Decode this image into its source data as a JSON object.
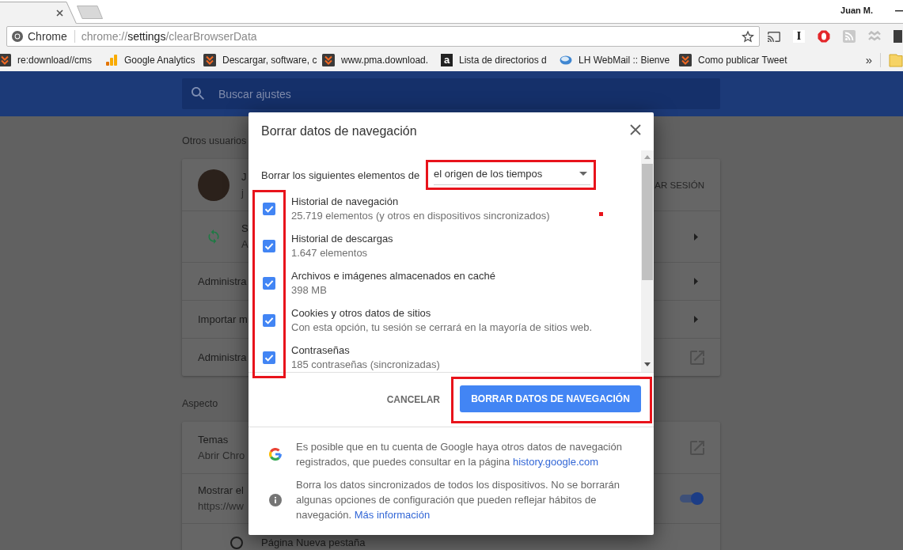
{
  "browser": {
    "profile_name": "Juan M.",
    "omnibox": {
      "chip": "Chrome",
      "url": {
        "scheme": "chrome://",
        "host": "settings",
        "path": "/clearBrowserData"
      },
      "starred": false
    },
    "extensions": [
      {
        "kind": "cast"
      },
      {
        "kind": "glyph",
        "glyph": "I"
      },
      {
        "kind": "octagon"
      },
      {
        "kind": "feed"
      },
      {
        "kind": "squiggle"
      },
      {
        "kind": "tile"
      }
    ],
    "bookmarks": [
      {
        "kind": "chevrons",
        "label": "re:download//cms"
      },
      {
        "kind": "bars",
        "label": "Google Analytics"
      },
      {
        "kind": "chevrons",
        "label": "Descargar, software, c"
      },
      {
        "kind": "chevrons",
        "label": "www.pma.download."
      },
      {
        "kind": "glyph",
        "glyph": "a",
        "label": "Lista de directorios d"
      },
      {
        "kind": "disc",
        "label": "LH WebMail :: Bienve"
      },
      {
        "kind": "chevrons",
        "label": "Como publicar Tweet"
      }
    ],
    "bookmarks_overflow": "»"
  },
  "settings": {
    "search": {
      "placeholder": "Buscar ajustes"
    },
    "sections": [
      {
        "title": "Otros usuarios",
        "rows": [
          {
            "kind": "profile",
            "title": "J",
            "subtitle": "j",
            "action": "AR SESIÓN"
          },
          {
            "kind": "sync",
            "title": "S",
            "subtitle": "A"
          },
          {
            "kind": "submenu",
            "title": "Administra"
          },
          {
            "kind": "submenu",
            "title": "Importar m"
          },
          {
            "kind": "external",
            "title": "Administra"
          }
        ]
      },
      {
        "title": "Aspecto",
        "rows": [
          {
            "kind": "external",
            "title": "Temas",
            "subtitle": "Abrir Chro"
          },
          {
            "kind": "toggle",
            "title": "Mostrar el",
            "subtitle": "https://ww",
            "on": true
          },
          {
            "kind": "radio",
            "title": "Página Nueva pestaña",
            "selected": false
          }
        ]
      }
    ]
  },
  "dialog": {
    "title": "Borrar datos de navegación",
    "range": {
      "label": "Borrar los siguientes elementos de",
      "value": "el origen de los tiempos",
      "highlighted": true
    },
    "items_highlighted": true,
    "items": [
      {
        "title": "Historial de navegación",
        "subtitle": "25.719 elementos (y otros en dispositivos sincronizados)",
        "checked": true
      },
      {
        "title": "Historial de descargas",
        "subtitle": "1.647 elementos",
        "checked": true
      },
      {
        "title": "Archivos e imágenes almacenados en caché",
        "subtitle": "398 MB",
        "checked": true
      },
      {
        "title": "Cookies y otros datos de sitios",
        "subtitle": "Con esta opción, tu sesión se cerrará en la mayoría de sitios web.",
        "checked": true
      },
      {
        "title": "Contraseñas",
        "subtitle": "185 contraseñas (sincronizadas)",
        "checked": true
      }
    ],
    "cancel": "CANCELAR",
    "confirm": {
      "label": "BORRAR DATOS DE NAVEGACIÓN",
      "highlighted": true
    },
    "notes": [
      {
        "kind": "google",
        "text": "Es posible que en tu cuenta de Google haya otros datos de navegación registrados, que puedes consultar en la página",
        "link": "history.google.com"
      },
      {
        "kind": "info",
        "text": "Borra los datos sincronizados de todos los dispositivos. No se borrarán algunas opciones de configuración que pueden reflejar hábitos de navegación.",
        "link": "Más información"
      }
    ]
  }
}
